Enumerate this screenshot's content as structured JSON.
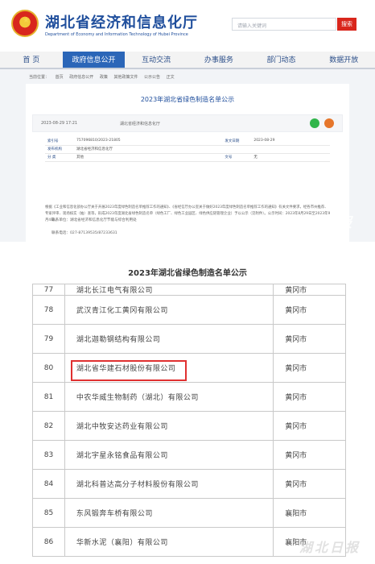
{
  "site": {
    "title": "湖北省经济和信息化厅",
    "subtitle": "Department of Economy and Information Technology of Hubei Province",
    "search_placeholder": "请输入关键词",
    "search_label": "搜索"
  },
  "nav": [
    "首 页",
    "政府信息公开",
    "互动交流",
    "办事服务",
    "部门动态",
    "数据开放"
  ],
  "breadcrumb": [
    "当前位置：",
    "首页",
    "政府信息公开",
    "政策",
    "其他政策文件",
    "公示公告",
    "正文"
  ],
  "document": {
    "title": "2023年湖北省绿色制造名单公示",
    "date": "2023-08-29 17:21",
    "source": "湖北省经济和信息化厅",
    "info_rows": [
      [
        "索引号",
        "757096810/2023-21805",
        "发文日期",
        "2023-08-29"
      ],
      [
        "发布机构",
        "湖北省经济和信息化厅",
        "",
        ""
      ],
      [
        "分  类",
        "其他",
        "文号",
        "无"
      ]
    ],
    "paragraph": "根据《工业和信息化部办公厅关于开展2023年度绿色制造名单推荐工作的通知》、《省经信厅办公室关于做好2023年度绿色制造名单推荐工作的通知》有关文件要求，经各市州推荐、专家评审、现场核实（抽）查等，形成2023年度湖北省绿色制造名单（绿色工厂、绿色工业园区、绿色供应链管理企业）予以公示（见附件）。公示时间：2023年8月29日至2023年9月4日。",
    "contact_unit": "联系单位：湖北省经济和信息化厅节能与综合利用处",
    "contact_phone": "联系电话：027-87139535/87233631"
  },
  "watermark": "湖北日报",
  "list": {
    "title": "2023年湖北省绿色制造名单公示",
    "rows": [
      {
        "no": "77",
        "name": "湖北长江电气有限公司",
        "city": "黄冈市"
      },
      {
        "no": "78",
        "name": "武汉青江化工黄冈有限公司",
        "city": "黄冈市"
      },
      {
        "no": "79",
        "name": "湖北迦勒钢结构有限公司",
        "city": "黄冈市"
      },
      {
        "no": "80",
        "name": "湖北省华建石材股份有限公司",
        "city": "黄冈市"
      },
      {
        "no": "81",
        "name": "中农华威生物制药（湖北）有限公司",
        "city": "黄冈市"
      },
      {
        "no": "82",
        "name": "湖北中牧安达药业有限公司",
        "city": "黄冈市"
      },
      {
        "no": "83",
        "name": "湖北宇星永铭食品有限公司",
        "city": "黄冈市"
      },
      {
        "no": "84",
        "name": "湖北科普达高分子材料股份有限公司",
        "city": "黄冈市"
      },
      {
        "no": "85",
        "name": "东风锻奔车桥有限公司",
        "city": "襄阳市"
      },
      {
        "no": "86",
        "name": "华新水泥（襄阳）有限公司",
        "city": "襄阳市"
      }
    ]
  }
}
